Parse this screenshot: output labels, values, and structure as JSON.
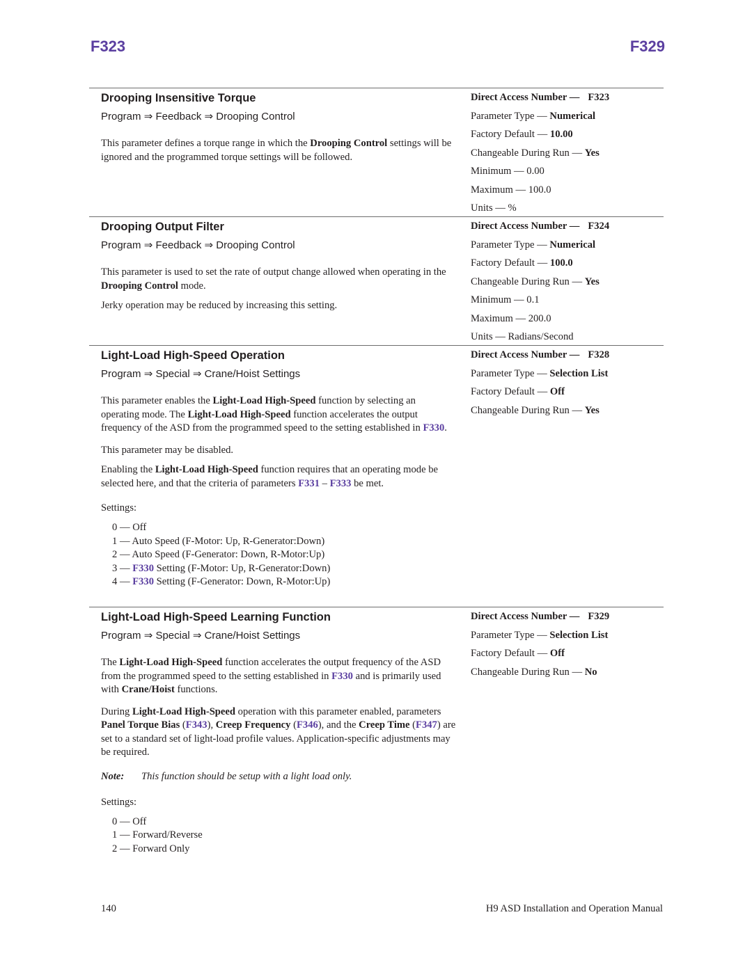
{
  "header": {
    "left_code": "F323",
    "right_code": "F329"
  },
  "colors": {
    "accent": "#5b3fa0",
    "text": "#231f20",
    "rule": "#6d6d6d"
  },
  "sections": [
    {
      "title": "Drooping Insensitive Torque",
      "path": [
        "Program",
        "Feedback",
        "Drooping Control"
      ],
      "path_sep": "⇒",
      "paragraphs": [
        {
          "p1": "This parameter defines a torque range in which the ",
          "b1": "Drooping Control",
          "p2": " settings will be ignored and the programmed torque settings will be followed."
        }
      ],
      "specs": {
        "dan_label": "Direct Access Number —",
        "dan": "F323",
        "type_label": "Parameter Type — ",
        "type": "Numerical",
        "default_label": "Factory Default — ",
        "default": "10.00",
        "run_label": "Changeable During Run — ",
        "run": "Yes",
        "min": "Minimum — 0.00",
        "max": "Maximum — 100.0",
        "units": "Units — %"
      }
    },
    {
      "title": "Drooping Output Filter",
      "path": [
        "Program",
        "Feedback",
        "Drooping Control"
      ],
      "paragraphs": [
        {
          "p1": "This parameter is used to set the rate of output change allowed when operating in the ",
          "b1": "Drooping Control",
          "p2": " mode."
        },
        {
          "p1": "Jerky operation may be reduced by increasing this setting."
        }
      ],
      "specs": {
        "dan_label": "Direct Access Number —",
        "dan": "F324",
        "type_label": "Parameter Type — ",
        "type": "Numerical",
        "default_label": "Factory Default — ",
        "default": "100.0",
        "run_label": "Changeable During Run — ",
        "run": "Yes",
        "min": "Minimum — 0.1",
        "max": "Maximum — 200.0",
        "units": "Units — Radians/Second"
      }
    },
    {
      "title": "Light-Load High-Speed Operation",
      "path": [
        "Program",
        "Special",
        "Crane/Hoist Settings"
      ],
      "paragraphs": [
        {
          "p1": "This parameter enables the ",
          "b1": "Light-Load High-Speed",
          "p2": " function by selecting an operating mode. The ",
          "b2": "Light-Load High-Speed",
          "p3": " function accelerates the output frequency of the ASD from the programmed speed to the setting established in ",
          "l1": "F330",
          "p4": "."
        },
        {
          "p1": "This parameter may be disabled."
        },
        {
          "p1": "Enabling the ",
          "b1": "Light-Load High-Speed",
          "p2": " function requires that an operating mode be selected here, and that the criteria of parameters ",
          "l1": "F331",
          "p3": " – ",
          "l2": "F333",
          "p4": " be met."
        }
      ],
      "settings_label": "Settings:",
      "settings": [
        {
          "prefix": "0 — ",
          "link": "",
          "text": "Off"
        },
        {
          "prefix": "1 — ",
          "link": "",
          "text": "Auto Speed (F-Motor: Up, R-Generator:Down)"
        },
        {
          "prefix": "2 — ",
          "link": "",
          "text": "Auto Speed (F-Generator: Down, R-Motor:Up)"
        },
        {
          "prefix": "3 — ",
          "link": "F330",
          "text": " Setting (F-Motor: Up, R-Generator:Down)"
        },
        {
          "prefix": "4 — ",
          "link": "F330",
          "text": " Setting (F-Generator: Down, R-Motor:Up)"
        }
      ],
      "specs": {
        "dan_label": "Direct Access Number —",
        "dan": "F328",
        "type_label": "Parameter Type — ",
        "type": "Selection List",
        "default_label": "Factory Default — ",
        "default": "Off",
        "run_label": "Changeable During Run — ",
        "run": "Yes"
      }
    },
    {
      "title": "Light-Load High-Speed Learning Function",
      "path": [
        "Program",
        "Special",
        "Crane/Hoist Settings"
      ],
      "paragraphs": [
        {
          "p1": "The ",
          "b1": "Light-Load High-Speed",
          "p2": " function accelerates the output frequency of the ASD from the programmed speed to the setting established in ",
          "l1": "F330",
          "p3": " and is primarily used with ",
          "b2": "Crane/Hoist",
          "p4": " functions."
        },
        {
          "p1": "During ",
          "b1": "Light-Load High-Speed",
          "p2": " operation with this parameter enabled, parameters ",
          "b2": "Panel Torque Bias",
          "p3": " (",
          "l1": "F343",
          "p4": "), ",
          "b3": "Creep Frequency",
          "p5": " (",
          "l2": "F346",
          "p6": "), and the ",
          "b4": "Creep Time",
          "p7": " (",
          "l3": "F347",
          "p8": ") are set to a standard set of light-load profile values. Application-specific adjustments may be required."
        }
      ],
      "note": {
        "label": "Note:",
        "text": "This function should be setup with a light load only."
      },
      "settings_label": "Settings:",
      "settings": [
        {
          "prefix": "0 — ",
          "text": "Off"
        },
        {
          "prefix": "1 — ",
          "text": "Forward/Reverse"
        },
        {
          "prefix": "2 — ",
          "text": "Forward Only"
        }
      ],
      "specs": {
        "dan_label": "Direct Access Number —",
        "dan": "F329",
        "type_label": "Parameter Type — ",
        "type": "Selection List",
        "default_label": "Factory Default — ",
        "default": "Off",
        "run_label": "Changeable During Run — ",
        "run": "No"
      }
    }
  ],
  "footer": {
    "page_number": "140",
    "manual_title": "H9 ASD Installation and Operation Manual"
  }
}
